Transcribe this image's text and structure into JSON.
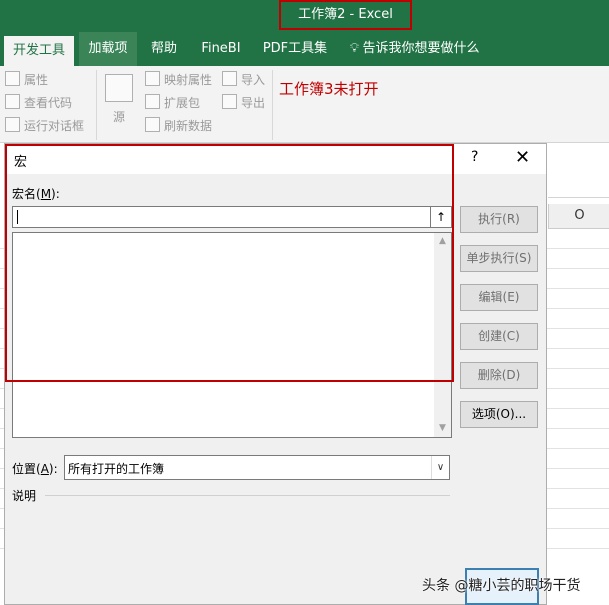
{
  "window": {
    "title": "工作簿2  -  Excel"
  },
  "tabs": [
    {
      "label": "开发工具",
      "active": true
    },
    {
      "label": "加载项",
      "active": false
    },
    {
      "label": "帮助",
      "active": false
    },
    {
      "label": "FineBI",
      "active": false
    },
    {
      "label": "PDF工具集",
      "active": false
    },
    {
      "label": "告诉我你想要做什么",
      "active": false,
      "icon": "lightbulb-icon"
    }
  ],
  "ribbon": {
    "controls": [
      "属性",
      "查看代码",
      "运行对话框"
    ],
    "source": "源",
    "xml": [
      "映射属性",
      "扩展包",
      "刷新数据"
    ],
    "io": [
      "导入",
      "导出"
    ],
    "note": "工作簿3未打开"
  },
  "sheet": {
    "column_o": "O"
  },
  "dialog": {
    "title": "宏",
    "help": "?",
    "close": "✕",
    "macro_name_label": "宏名(",
    "macro_name_key": "M",
    "macro_name_suffix": "):",
    "macro_name_value": "",
    "buttons": {
      "run": "执行(R)",
      "step": "单步执行(S)",
      "edit": "编辑(E)",
      "create": "创建(C)",
      "delete": "删除(D)",
      "options": "选项(O)..."
    },
    "location_label": "位置(",
    "location_key": "A",
    "location_suffix": "):",
    "location_value": "所有打开的工作簿",
    "description_label": "说明"
  },
  "watermark": "头条 @糖小芸的职场干货"
}
